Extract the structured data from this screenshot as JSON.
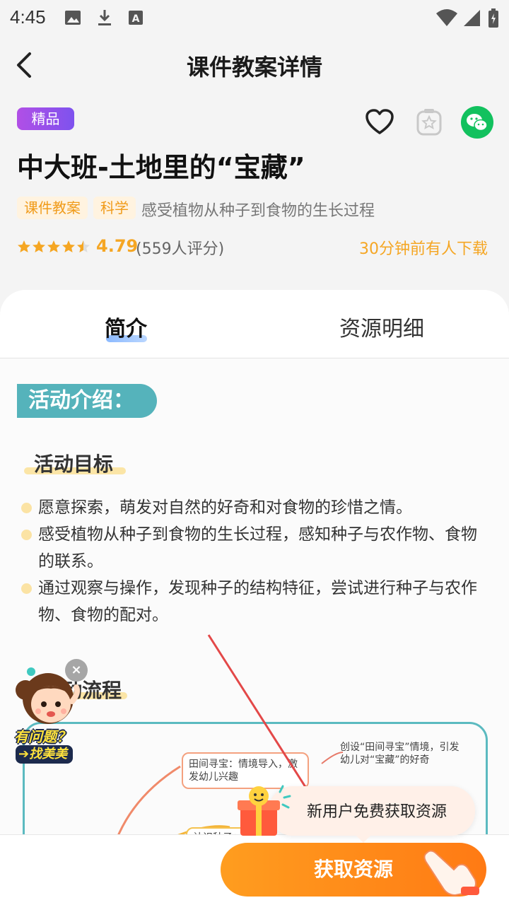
{
  "status_bar": {
    "time": "4:45"
  },
  "nav": {
    "title": "课件教案详情"
  },
  "resource": {
    "badge": "精品",
    "title": "中大班-土地里的“宝藏”",
    "tags": [
      "课件教案",
      "科学"
    ],
    "description": "感受植物从种子到食物的生长过程",
    "rating": "4.79",
    "rating_count": "(559人评分)",
    "download_note": "30分钟前有人下载"
  },
  "tabs": [
    {
      "label": "简介",
      "active": true
    },
    {
      "label": "资源明细",
      "active": false
    }
  ],
  "doc": {
    "section_heading": "活动介绍：",
    "goals_heading": "活动目标",
    "goals": [
      "愿意探索，萌发对自然的好奇和对食物的珍惜之情。",
      "感受植物从种子到食物的生长过程，感知种子与农作物、食物的联系。",
      "通过观察与操作，发现种子的结构特征，尝试进行种子与农作物、食物的配对。"
    ],
    "flow_heading": "动流程",
    "flow_nodes": [
      "田间寻宝：情境导入，激发幼儿兴趣",
      "创设“田间寻宝”情境，引发幼儿对“宝藏”的好奇",
      "认识种子：观"
    ]
  },
  "helper": {
    "line1": "有问题？",
    "line2": "找美美",
    "close": "×"
  },
  "promo": {
    "text": "新用户免费获取资源"
  },
  "cta": {
    "label": "获取资源"
  },
  "colors": {
    "accent": "#ff8a1a",
    "tag_text": "#f09b1a",
    "doc_teal": "#55b3bb",
    "wechat": "#12c15e",
    "badge": "#9a50ea"
  }
}
